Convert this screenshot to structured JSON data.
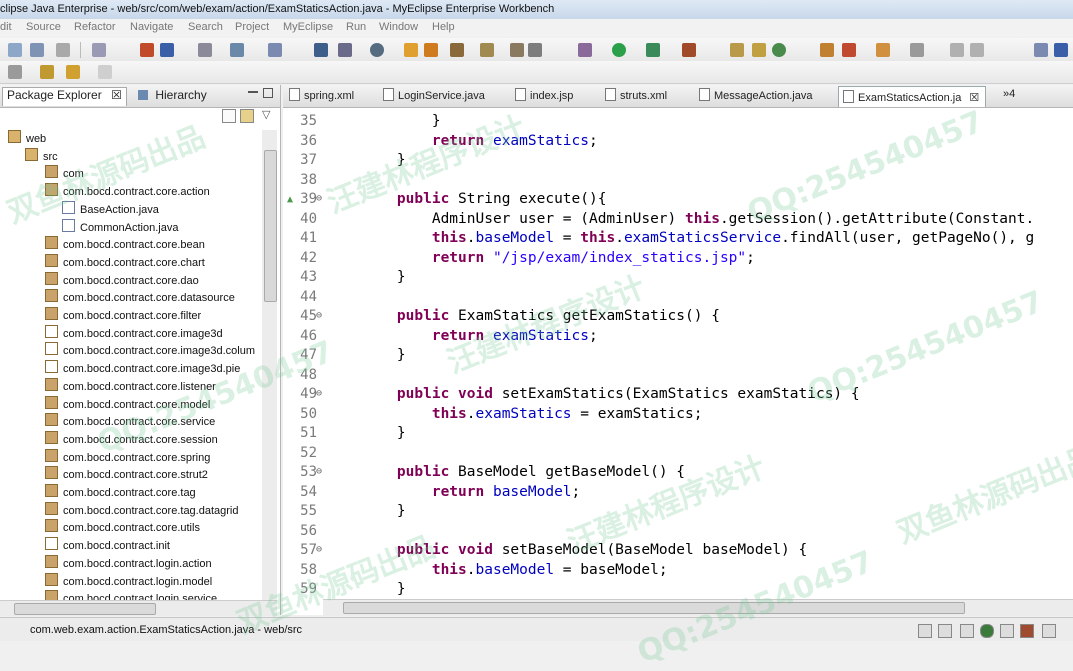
{
  "window": {
    "title": "clipse Java Enterprise - web/src/com/web/exam/action/ExamStaticsAction.java - MyEclipse Enterprise Workbench"
  },
  "menu": [
    "dit",
    "Source",
    "Refactor",
    "Navigate",
    "Search",
    "Project",
    "MyEclipse",
    "Run",
    "Window",
    "Help"
  ],
  "left_panel": {
    "tabs": [
      {
        "label": "Package Explorer",
        "close": "☒"
      },
      {
        "label": "Hierarchy"
      }
    ],
    "tree": [
      {
        "label": "web",
        "icon": "project-icon",
        "level": 0
      },
      {
        "label": "src",
        "icon": "source-folder-icon",
        "level": 1
      },
      {
        "label": "com",
        "icon": "package-icon",
        "level": 2
      },
      {
        "label": "com.bocd.contract.core.action",
        "icon": "package-icon",
        "level": 2
      },
      {
        "label": "BaseAction.java",
        "icon": "java-file-icon",
        "level": 3
      },
      {
        "label": "CommonAction.java",
        "icon": "java-file-icon",
        "level": 3
      },
      {
        "label": "com.bocd.contract.core.bean",
        "icon": "package-icon",
        "level": 2
      },
      {
        "label": "com.bocd.contract.core.chart",
        "icon": "package-icon",
        "level": 2
      },
      {
        "label": "com.bocd.contract.core.dao",
        "icon": "package-icon",
        "level": 2
      },
      {
        "label": "com.bocd.contract.core.datasource",
        "icon": "package-icon",
        "level": 2
      },
      {
        "label": "com.bocd.contract.core.filter",
        "icon": "package-icon",
        "level": 2
      },
      {
        "label": "com.bocd.contract.core.image3d",
        "icon": "package-empty-icon",
        "level": 2
      },
      {
        "label": "com.bocd.contract.core.image3d.colum",
        "icon": "package-empty-icon",
        "level": 2
      },
      {
        "label": "com.bocd.contract.core.image3d.pie",
        "icon": "package-empty-icon",
        "level": 2
      },
      {
        "label": "com.bocd.contract.core.listener",
        "icon": "package-icon",
        "level": 2
      },
      {
        "label": "com.bocd.contract.core.model",
        "icon": "package-icon",
        "level": 2
      },
      {
        "label": "com.bocd.contract.core.service",
        "icon": "package-icon",
        "level": 2
      },
      {
        "label": "com.bocd.contract.core.session",
        "icon": "package-icon",
        "level": 2
      },
      {
        "label": "com.bocd.contract.core.spring",
        "icon": "package-icon",
        "level": 2
      },
      {
        "label": "com.bocd.contract.core.strut2",
        "icon": "package-icon",
        "level": 2
      },
      {
        "label": "com.bocd.contract.core.tag",
        "icon": "package-icon",
        "level": 2
      },
      {
        "label": "com.bocd.contract.core.tag.datagrid",
        "icon": "package-icon",
        "level": 2
      },
      {
        "label": "com.bocd.contract.core.utils",
        "icon": "package-icon",
        "level": 2
      },
      {
        "label": "com.bocd.contract.init",
        "icon": "package-empty-icon",
        "level": 2
      },
      {
        "label": "com.bocd.contract.login.action",
        "icon": "package-icon",
        "level": 2
      },
      {
        "label": "com.bocd.contract.login.model",
        "icon": "package-icon",
        "level": 2
      },
      {
        "label": "com.bocd.contract.login.service",
        "icon": "package-icon",
        "level": 2
      }
    ]
  },
  "editor": {
    "tabs": [
      {
        "label": "spring.xml"
      },
      {
        "label": "LoginService.java"
      },
      {
        "label": "index.jsp"
      },
      {
        "label": "struts.xml"
      },
      {
        "label": "MessageAction.java"
      },
      {
        "label": "ExamStaticsAction.ja",
        "active": true,
        "close": "☒"
      },
      {
        "label": "»4"
      }
    ],
    "lines": [
      {
        "n": "35",
        "tokens": [
          [
            "p",
            "        }"
          ]
        ]
      },
      {
        "n": "36",
        "tokens": [
          [
            "p",
            "        "
          ],
          [
            "k",
            "return"
          ],
          [
            "p",
            " "
          ],
          [
            "f",
            "examStatics"
          ],
          [
            "p",
            ";"
          ]
        ]
      },
      {
        "n": "37",
        "tokens": [
          [
            "p",
            "    }"
          ]
        ]
      },
      {
        "n": "38",
        "tokens": []
      },
      {
        "n": "39",
        "marker": "⊖",
        "arrow": "▲",
        "tokens": [
          [
            "p",
            "    "
          ],
          [
            "k",
            "public"
          ],
          [
            "p",
            " String execute(){"
          ]
        ]
      },
      {
        "n": "40",
        "tokens": [
          [
            "p",
            "        AdminUser user = (AdminUser) "
          ],
          [
            "k",
            "this"
          ],
          [
            "p",
            ".getSession().getAttribute(Constant."
          ]
        ]
      },
      {
        "n": "41",
        "tokens": [
          [
            "p",
            "        "
          ],
          [
            "k",
            "this"
          ],
          [
            "p",
            "."
          ],
          [
            "f",
            "baseModel"
          ],
          [
            "p",
            " = "
          ],
          [
            "k",
            "this"
          ],
          [
            "p",
            "."
          ],
          [
            "f",
            "examStaticsService"
          ],
          [
            "p",
            ".findAll(user, getPageNo(), g"
          ]
        ]
      },
      {
        "n": "42",
        "tokens": [
          [
            "p",
            "        "
          ],
          [
            "k",
            "return"
          ],
          [
            "p",
            " "
          ],
          [
            "s",
            "\"/jsp/exam/index_statics.jsp\""
          ],
          [
            "p",
            ";"
          ]
        ]
      },
      {
        "n": "43",
        "tokens": [
          [
            "p",
            "    }"
          ]
        ]
      },
      {
        "n": "44",
        "tokens": []
      },
      {
        "n": "45",
        "marker": "⊖",
        "tokens": [
          [
            "p",
            "    "
          ],
          [
            "k",
            "public"
          ],
          [
            "p",
            " ExamStatics getExamStatics() {"
          ]
        ]
      },
      {
        "n": "46",
        "tokens": [
          [
            "p",
            "        "
          ],
          [
            "k",
            "return"
          ],
          [
            "p",
            " "
          ],
          [
            "f",
            "examStatics"
          ],
          [
            "p",
            ";"
          ]
        ]
      },
      {
        "n": "47",
        "tokens": [
          [
            "p",
            "    }"
          ]
        ]
      },
      {
        "n": "48",
        "tokens": []
      },
      {
        "n": "49",
        "marker": "⊖",
        "tokens": [
          [
            "p",
            "    "
          ],
          [
            "k",
            "public"
          ],
          [
            "p",
            " "
          ],
          [
            "k",
            "void"
          ],
          [
            "p",
            " setExamStatics(ExamStatics examStatics) {"
          ]
        ]
      },
      {
        "n": "50",
        "tokens": [
          [
            "p",
            "        "
          ],
          [
            "k",
            "this"
          ],
          [
            "p",
            "."
          ],
          [
            "f",
            "examStatics"
          ],
          [
            "p",
            " = examStatics;"
          ]
        ]
      },
      {
        "n": "51",
        "tokens": [
          [
            "p",
            "    }"
          ]
        ]
      },
      {
        "n": "52",
        "tokens": []
      },
      {
        "n": "53",
        "marker": "⊖",
        "tokens": [
          [
            "p",
            "    "
          ],
          [
            "k",
            "public"
          ],
          [
            "p",
            " BaseModel getBaseModel() {"
          ]
        ]
      },
      {
        "n": "54",
        "tokens": [
          [
            "p",
            "        "
          ],
          [
            "k",
            "return"
          ],
          [
            "p",
            " "
          ],
          [
            "f",
            "baseModel"
          ],
          [
            "p",
            ";"
          ]
        ]
      },
      {
        "n": "55",
        "tokens": [
          [
            "p",
            "    }"
          ]
        ]
      },
      {
        "n": "56",
        "tokens": []
      },
      {
        "n": "57",
        "marker": "⊖",
        "tokens": [
          [
            "p",
            "    "
          ],
          [
            "k",
            "public"
          ],
          [
            "p",
            " "
          ],
          [
            "k",
            "void"
          ],
          [
            "p",
            " setBaseModel(BaseModel baseModel) {"
          ]
        ]
      },
      {
        "n": "58",
        "tokens": [
          [
            "p",
            "        "
          ],
          [
            "k",
            "this"
          ],
          [
            "p",
            "."
          ],
          [
            "f",
            "baseModel"
          ],
          [
            "p",
            " = baseModel;"
          ]
        ]
      },
      {
        "n": "59",
        "tokens": [
          [
            "p",
            "    }"
          ]
        ]
      }
    ]
  },
  "status": {
    "text": "com.web.exam.action.ExamStaticsAction.java - web/src"
  },
  "watermarks": [
    "汪建林程序设计",
    "QQ:254540457",
    "双鱼林源码出品"
  ]
}
